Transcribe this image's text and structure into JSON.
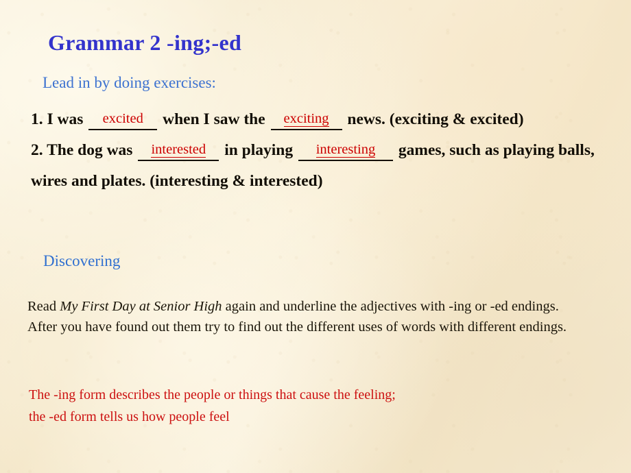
{
  "slide": {
    "title": "Grammar 2 -ing;-ed",
    "background_color": "#f7ecd2",
    "title_color": "#3333cc",
    "heading_color": "#3d72d0",
    "answer_color": "#cc0000",
    "note_color": "#cc1111"
  },
  "lead_in": {
    "heading": "Lead in by doing exercises:",
    "exercise_1": {
      "number": "1.",
      "part_a": "I was",
      "answer_1": "excited",
      "part_b": "when I saw the",
      "answer_2": "exciting",
      "part_c": "news. (exciting & excited)"
    },
    "exercise_2": {
      "number": "2.",
      "part_a": "The dog was",
      "answer_1": "interested",
      "part_b": "in playing",
      "answer_2": "interesting",
      "part_c": "games, such as playing balls, wires and plates. (interesting & interested)"
    }
  },
  "discovering": {
    "heading": "Discovering",
    "instruction_before_title": "Read",
    "book_title": "My First Day at Senior High",
    "instruction_after_title": "again and underline the adjectives with -ing or -ed endings. After you have found out them try to find out the different uses of words with different endings.",
    "rule_note_line_1": "The -ing form describes the people or things that cause the feeling;",
    "rule_note_line_2": "the -ed form tells us how people feel"
  }
}
